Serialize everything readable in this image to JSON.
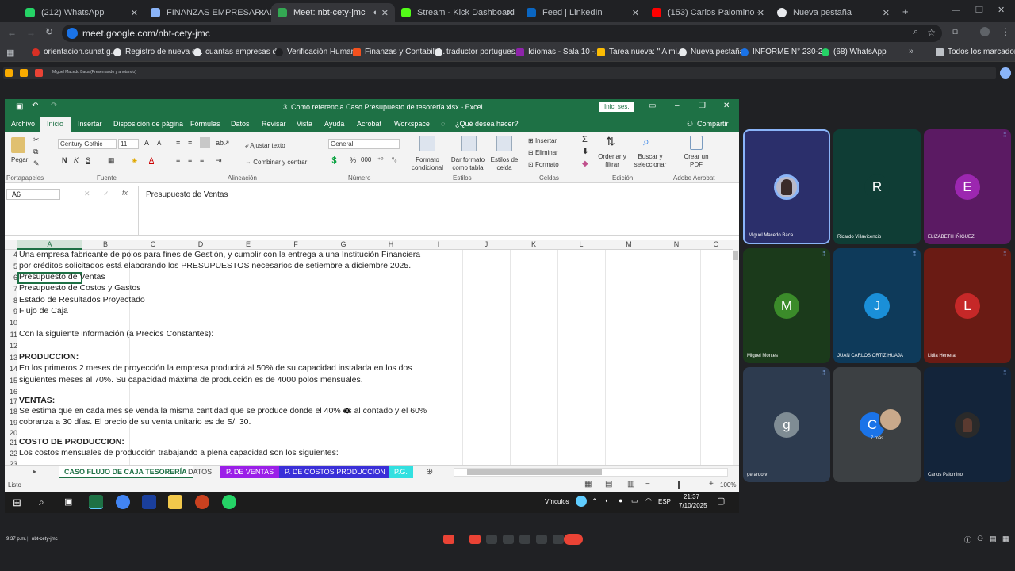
{
  "browser": {
    "tabs": [
      {
        "title": "(212) WhatsApp",
        "color": "#25d366"
      },
      {
        "title": "FINANZAS EMPRESARIALES.pdf",
        "color": "#8ab4f8"
      },
      {
        "title": "Meet: nbt-cety-jmc",
        "color": "#34a853",
        "active": true
      },
      {
        "title": "Stream - Kick Dashboard",
        "color": "#53fc18"
      },
      {
        "title": "Feed | LinkedIn",
        "color": "#0a66c2"
      },
      {
        "title": "(153) Carlos Palomino - YouTu...",
        "color": "#ff0000"
      },
      {
        "title": "Nueva pestaña",
        "color": "#e8eaed"
      }
    ],
    "url": "meet.google.com/nbt-cety-jmc",
    "bookmarks": [
      "orientacion.sunat.g...",
      "Registro de nueva e...",
      "cuantas empresas d...",
      "Verificación Humana",
      "Finanzas y Contabilid...",
      "traductor portugues...",
      "Idiomas - Sala 10 -...",
      "Tarea nueva: \" A mi...",
      "Nueva pestaña",
      "INFORME N° 230-2...",
      "(68) WhatsApp"
    ],
    "all_bookmarks": "Todos los marcadores"
  },
  "presenter_bar": "Miguel Macedo Baca (Presentando y anotando)",
  "excel": {
    "title": "3. Como referencia Caso Presupuesto de tesorería.xlsx  -  Excel",
    "signin": "Inic. ses.",
    "menu_tabs": [
      "Archivo",
      "Inicio",
      "Insertar",
      "Disposición de página",
      "Fórmulas",
      "Datos",
      "Revisar",
      "Vista",
      "Ayuda",
      "Acrobat",
      "Workspace"
    ],
    "tell_me": "¿Qué desea hacer?",
    "share": "Compartir",
    "ribbon": {
      "paste": "Pegar",
      "clipboard": "Portapapeles",
      "font_name": "Century Gothic",
      "font_size": "11",
      "font_group": "Fuente",
      "wrap_text": "Ajustar texto",
      "merge": "Combinar y centrar",
      "alignment": "Alineación",
      "number_format": "General",
      "number": "Número",
      "cond_format": "Formato condicional",
      "format_table": "Dar formato como tabla",
      "cell_styles": "Estilos de celda",
      "styles": "Estilos",
      "insert": "Insertar",
      "delete": "Eliminar",
      "format": "Formato",
      "cells": "Celdas",
      "sort_filter": "Ordenar y filtrar",
      "find_select": "Buscar y seleccionar",
      "editing": "Edición",
      "create_pdf": "Crear un PDF",
      "adobe": "Adobe Acrobat"
    },
    "name_box": "A6",
    "formula": "Presupuesto de Ventas",
    "columns": [
      "A",
      "B",
      "C",
      "D",
      "E",
      "F",
      "G",
      "H",
      "I",
      "J",
      "K",
      "L",
      "M",
      "N",
      "O"
    ],
    "rows": [
      {
        "n": "4",
        "text": "Una empresa fabricante de polos para fines de Gestión, y cumplir con la entrega a una Institución Financiera"
      },
      {
        "n": "5",
        "text": "por créditos solicitados está elaborando los PRESUPUESTOS necesarios de setiembre a diciembre 2025."
      },
      {
        "n": "6",
        "text": "Presupuesto de Ventas"
      },
      {
        "n": "7",
        "text": "Presupuesto de Costos y Gastos"
      },
      {
        "n": "8",
        "text": "Estado de Resultados Proyectado"
      },
      {
        "n": "9",
        "text": "Flujo de Caja"
      },
      {
        "n": "10",
        "text": ""
      },
      {
        "n": "11",
        "text": "Con la siguiente información (a Precios Constantes):"
      },
      {
        "n": "12",
        "text": ""
      },
      {
        "n": "13",
        "text": "PRODUCCION:",
        "bold": true
      },
      {
        "n": "14",
        "text": "En los primeros 2 meses de proyección la empresa producirá al 50% de su capacidad instalada en los dos"
      },
      {
        "n": "15",
        "text": "siguientes meses al 70%. Su capacidad máxima de producción es de 4000 polos mensuales."
      },
      {
        "n": "16",
        "text": ""
      },
      {
        "n": "17",
        "text": "VENTAS:",
        "bold": true
      },
      {
        "n": "18",
        "text": "Se estima que en cada mes se venda la misma cantidad que se produce donde el 40% es al contado y el 60%"
      },
      {
        "n": "19",
        "text": "cobranza a 30 días. El precio de su venta unitario es de S/. 30."
      },
      {
        "n": "20",
        "text": ""
      },
      {
        "n": "21",
        "text": "COSTO DE PRODUCCION:",
        "bold": true
      },
      {
        "n": "22",
        "text": "Los costos mensuales de producción trabajando a plena capacidad son los siguientes:"
      },
      {
        "n": "23",
        "text": ""
      }
    ],
    "sheets": [
      {
        "name": "CASO FLUJO DE CAJA TESORERÍA",
        "color": "#ffffff",
        "text": "#1e7145"
      },
      {
        "name": "DATOS",
        "color": "#f3f3f3",
        "text": "#444444"
      },
      {
        "name": "P. DE VENTAS",
        "color": "#9b1fe8",
        "text": "#ffffff"
      },
      {
        "name": "P. DE COSTOS PRODUCCION",
        "color": "#3a2fd8",
        "text": "#ffffff"
      },
      {
        "name": "P.G.",
        "color": "#32e0e0",
        "text": "#ffffff"
      }
    ],
    "status": "Listo",
    "zoom": "100%"
  },
  "taskbar": {
    "vinculos": "Vínculos",
    "lang": "ESP",
    "time": "21:37",
    "date": "7/10/2025"
  },
  "participants": [
    {
      "name": "Miguel Macedo Baca",
      "initial": "",
      "bg": "#2b2f6b",
      "photo": true,
      "highlight": true
    },
    {
      "name": "Ricardo Villavicencio",
      "initial": "R",
      "bg": "#0f3d35",
      "avatar": "#0f3d35"
    },
    {
      "name": "ELIZABETH IÑIGUEZ",
      "initial": "E",
      "bg": "#5b1a63",
      "avatar": "#9c27b0"
    },
    {
      "name": "Miguel Montes",
      "initial": "M",
      "bg": "#1b3a1b",
      "avatar": "#3b8b2a"
    },
    {
      "name": "JUAN CARLOS ORTIZ HUAJA",
      "initial": "J",
      "bg": "#0e3a5a",
      "avatar": "#1a8fd8"
    },
    {
      "name": "Lidia Herrera",
      "initial": "L",
      "bg": "#6a1b14",
      "avatar": "#c62828"
    },
    {
      "name": "gerardo v",
      "initial": "g",
      "bg": "#2d3b4f",
      "avatar": "#7f8c94"
    },
    {
      "name": "7 más",
      "initial": "C",
      "bg": "#3c4043",
      "avatar": "#1a73e8"
    },
    {
      "name": "Carlos Palomino",
      "initial": "",
      "bg": "#13243a",
      "photo": true
    }
  ],
  "meet_bottom": {
    "time": "9:37 p.m.",
    "meeting_code": "nbt-cety-jmc"
  }
}
